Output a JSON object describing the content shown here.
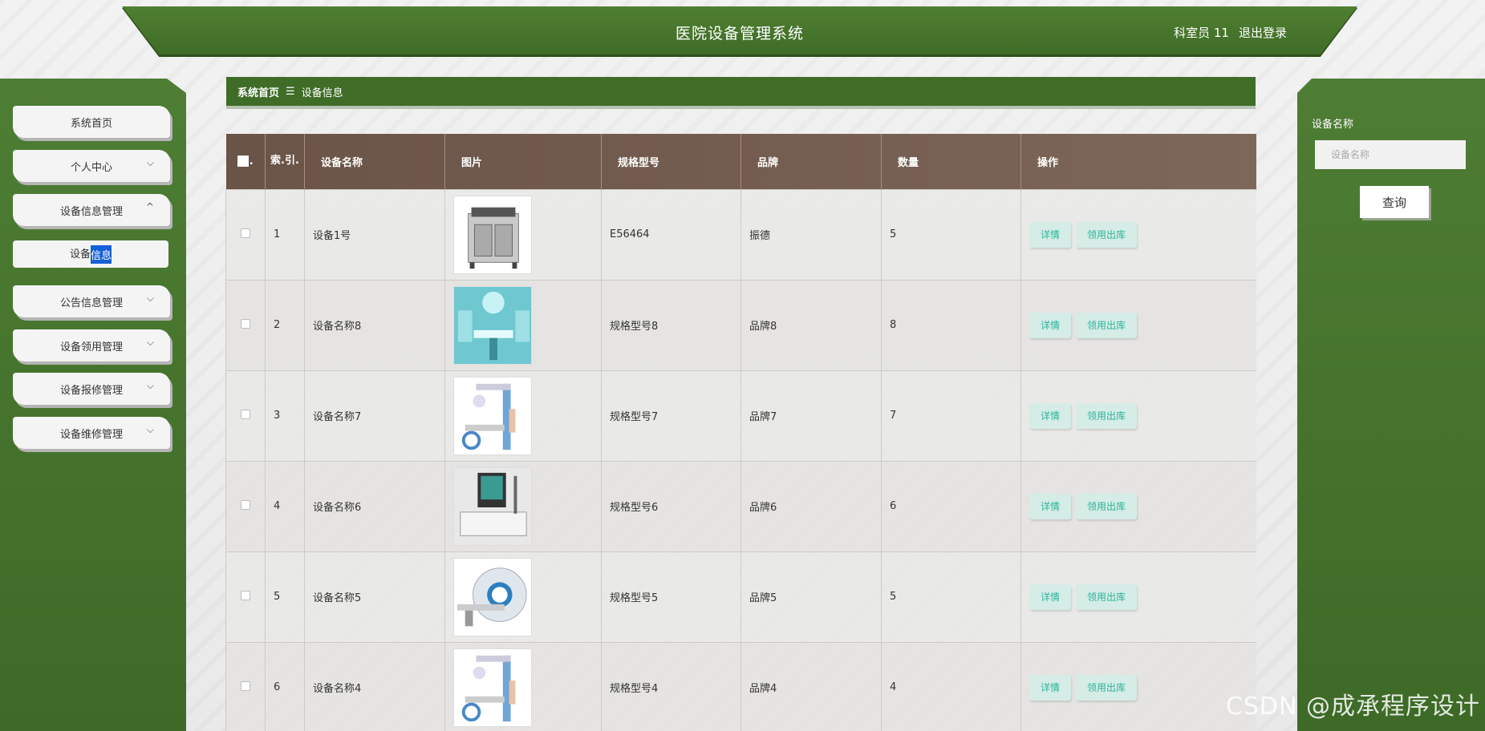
{
  "header": {
    "title": "医院设备管理系统",
    "user": "科室员 11",
    "logout": "退出登录"
  },
  "sidebar": {
    "items": [
      {
        "label": "系统首页"
      },
      {
        "label": "个人中心"
      },
      {
        "label": "设备信息管理"
      },
      {
        "label_before": "设备",
        "label_highlight": "信息"
      },
      {
        "label": "公告信息管理"
      },
      {
        "label": "设备领用管理"
      },
      {
        "label": "设备报修管理"
      },
      {
        "label": "设备维修管理"
      }
    ]
  },
  "breadcrumb": {
    "home": "系统首页",
    "separator": "☰",
    "current": "设备信息"
  },
  "search": {
    "label": "设备名称",
    "placeholder": "设备名称",
    "button": "查询"
  },
  "table": {
    "headers": {
      "index": "索.引.",
      "name": "设备名称",
      "image": "图片",
      "model": "规格型号",
      "brand": "品牌",
      "quantity": "数量",
      "actions": "操作"
    },
    "rows": [
      {
        "index": "1",
        "name": "设备1号",
        "model": "E56464",
        "brand": "振德",
        "quantity": "5",
        "image_icon": "fryer-equipment-image"
      },
      {
        "index": "2",
        "name": "设备名称8",
        "model": "规格型号8",
        "brand": "品牌8",
        "quantity": "8",
        "image_icon": "operating-room-image"
      },
      {
        "index": "3",
        "name": "设备名称7",
        "model": "规格型号7",
        "brand": "品牌7",
        "quantity": "7",
        "image_icon": "xray-machine-image"
      },
      {
        "index": "4",
        "name": "设备名称6",
        "model": "规格型号6",
        "brand": "品牌6",
        "quantity": "6",
        "image_icon": "monitor-cart-image"
      },
      {
        "index": "5",
        "name": "设备名称5",
        "model": "规格型号5",
        "brand": "品牌5",
        "quantity": "5",
        "image_icon": "ct-scanner-image"
      },
      {
        "index": "6",
        "name": "设备名称4",
        "model": "规格型号4",
        "brand": "品牌4",
        "quantity": "4",
        "image_icon": "xray-machine-image"
      }
    ],
    "detail_label": "详情",
    "checkout_label": "领用出库"
  },
  "watermark": "CSDN @成承程序设计",
  "colors": {
    "header_green": "#3f6c27",
    "table_header_brown": "#6a5347",
    "action_button_text": "#2bb39a"
  }
}
